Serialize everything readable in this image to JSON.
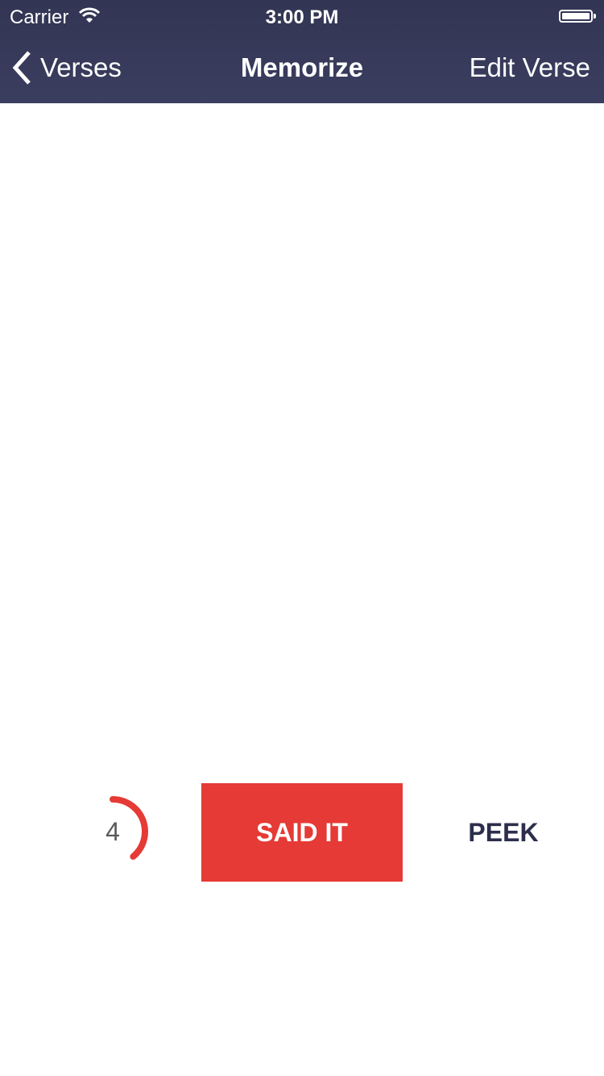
{
  "status_bar": {
    "carrier": "Carrier",
    "time": "3:00 PM",
    "wifi_icon": "wifi-icon",
    "battery_icon": "battery-icon"
  },
  "nav_bar": {
    "back_label": "Verses",
    "title": "Memorize",
    "right_label": "Edit Verse"
  },
  "controls": {
    "counter_value": "4",
    "counter_progress": 0.39,
    "said_it_label": "SAID IT",
    "peek_label": "PEEK"
  },
  "colors": {
    "nav_bg": "#343756",
    "accent_red": "#e53a35",
    "peek_text": "#2c2e4c"
  }
}
